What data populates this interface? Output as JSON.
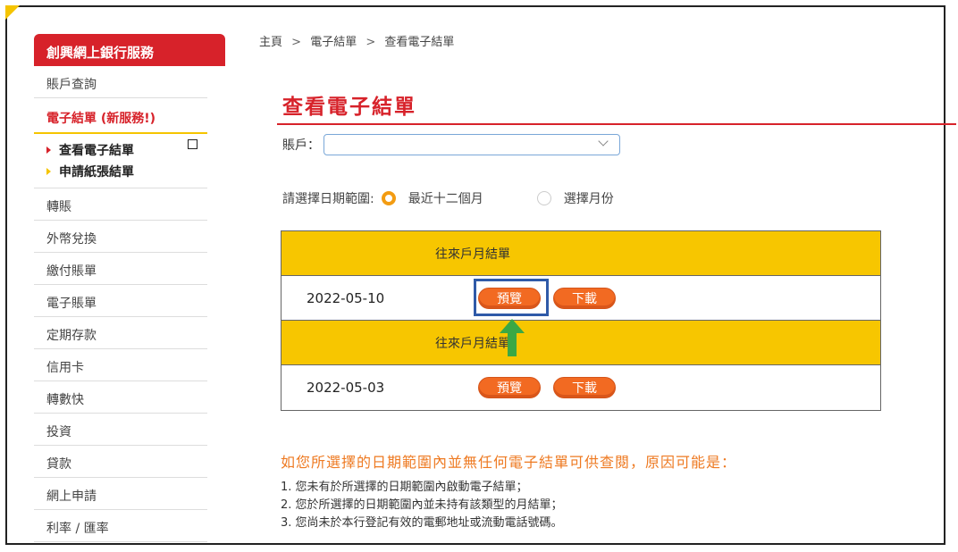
{
  "sidebar": {
    "header": "創興網上銀行服務",
    "items": [
      {
        "label": "賬戶查詢"
      },
      {
        "label": "電子結單 (新服務!)"
      },
      {
        "label": "轉賬"
      },
      {
        "label": "外幣兌換"
      },
      {
        "label": "繳付賬單"
      },
      {
        "label": "電子賬單"
      },
      {
        "label": "定期存款"
      },
      {
        "label": "信用卡"
      },
      {
        "label": "轉數快"
      },
      {
        "label": "投資"
      },
      {
        "label": "貸款"
      },
      {
        "label": "網上申請"
      },
      {
        "label": "利率 / 匯率"
      }
    ],
    "subitems": [
      {
        "label": "查看電子結單"
      },
      {
        "label": "申請紙張結單"
      }
    ]
  },
  "breadcrumb": {
    "home": "主頁",
    "level1": "電子結單",
    "current": "查看電子結單",
    "separator": ">"
  },
  "page_title": "查看電子結單",
  "account": {
    "label": "賬戶：",
    "value": ""
  },
  "date_range": {
    "label": "請選擇日期範圍:",
    "options": [
      {
        "label": "最近十二個月",
        "selected": true
      },
      {
        "label": "選擇月份",
        "selected": false
      }
    ]
  },
  "statements": [
    {
      "header": "往來戶月結單",
      "date": "2022-05-10",
      "preview_label": "預覽",
      "download_label": "下載"
    },
    {
      "header": "往來戶月結單",
      "date": "2022-05-03",
      "preview_label": "預覽",
      "download_label": "下載"
    }
  ],
  "notice": {
    "title": "如您所選擇的日期範圍內並無任何電子結單可供查閱，原因可能是：",
    "lines": [
      "1. 您未有於所選擇的日期範圍內啟動電子結單；",
      "2. 您於所選擇的日期範圍內並未持有該類型的月結單；",
      "3. 您尚未於本行登記有效的電郵地址或流動電話號碼。"
    ]
  },
  "colors": {
    "brand_red": "#d7222a",
    "yellow": "#f7c600",
    "button_orange": "#f26a22",
    "highlight_blue": "#2f5aa8",
    "arrow_green": "#3aa845"
  },
  "icons": {
    "chevron": "chevron-down-icon",
    "arrow": "arrow-up-icon",
    "bullet": "triangle-bullet-icon"
  }
}
